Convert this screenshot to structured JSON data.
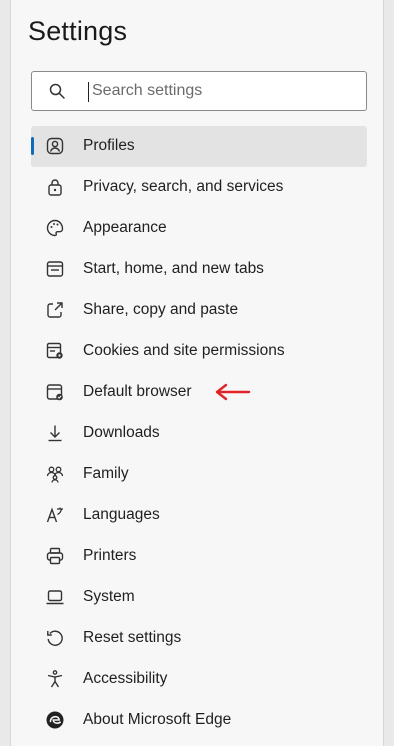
{
  "title": "Settings",
  "search": {
    "placeholder": "Search settings"
  },
  "nav": {
    "items": [
      {
        "label": "Profiles",
        "icon": "profiles-icon",
        "active": true
      },
      {
        "label": "Privacy, search, and services",
        "icon": "lock-icon"
      },
      {
        "label": "Appearance",
        "icon": "appearance-icon"
      },
      {
        "label": "Start, home, and new tabs",
        "icon": "start-home-icon"
      },
      {
        "label": "Share, copy and paste",
        "icon": "share-icon"
      },
      {
        "label": "Cookies and site permissions",
        "icon": "cookies-icon"
      },
      {
        "label": "Default browser",
        "icon": "default-browser-icon"
      },
      {
        "label": "Downloads",
        "icon": "download-icon"
      },
      {
        "label": "Family",
        "icon": "family-icon"
      },
      {
        "label": "Languages",
        "icon": "languages-icon"
      },
      {
        "label": "Printers",
        "icon": "printer-icon"
      },
      {
        "label": "System",
        "icon": "system-icon"
      },
      {
        "label": "Reset settings",
        "icon": "reset-icon"
      },
      {
        "label": "Accessibility",
        "icon": "accessibility-icon"
      },
      {
        "label": "About Microsoft Edge",
        "icon": "edge-logo-icon"
      }
    ]
  },
  "colors": {
    "accent": "#0f6cbd",
    "annotation_arrow": "#e0242a",
    "active_bg": "#e3e3e3"
  }
}
